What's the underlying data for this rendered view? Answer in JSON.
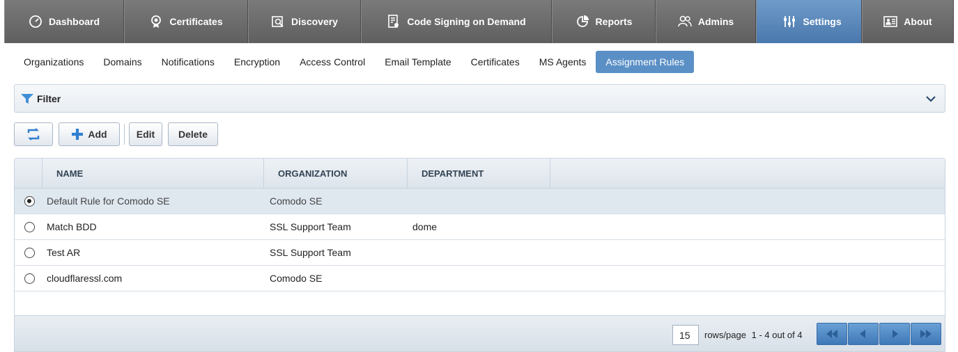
{
  "topnav": {
    "tabs": [
      {
        "label": "Dashboard",
        "icon": "dashboard-icon"
      },
      {
        "label": "Certificates",
        "icon": "certificate-icon"
      },
      {
        "label": "Discovery",
        "icon": "discovery-icon"
      },
      {
        "label": "Code Signing on Demand",
        "icon": "code-signing-icon"
      },
      {
        "label": "Reports",
        "icon": "reports-icon"
      },
      {
        "label": "Admins",
        "icon": "admins-icon"
      },
      {
        "label": "Settings",
        "icon": "settings-icon"
      },
      {
        "label": "About",
        "icon": "about-icon"
      }
    ],
    "active": "Settings"
  },
  "subnav": {
    "items": [
      "Organizations",
      "Domains",
      "Notifications",
      "Encryption",
      "Access Control",
      "Email Template",
      "Certificates",
      "MS Agents",
      "Assignment Rules"
    ],
    "active": "Assignment Rules"
  },
  "filter": {
    "label": "Filter"
  },
  "toolbar": {
    "add_label": "Add",
    "edit_label": "Edit",
    "delete_label": "Delete"
  },
  "table": {
    "columns": [
      "NAME",
      "ORGANIZATION",
      "DEPARTMENT"
    ],
    "rows": [
      {
        "name": "Default Rule for Comodo SE",
        "organization": "Comodo SE",
        "department": "",
        "selected": true
      },
      {
        "name": "Match BDD",
        "organization": "SSL Support Team",
        "department": "dome",
        "selected": false
      },
      {
        "name": "Test AR",
        "organization": "SSL Support Team",
        "department": "",
        "selected": false
      },
      {
        "name": "cloudflaressl.com",
        "organization": "Comodo SE",
        "department": "",
        "selected": false
      }
    ]
  },
  "pagination": {
    "rows_per_page": "15",
    "rows_per_page_label": "rows/page",
    "range_text": "1 - 4 out of 4"
  },
  "colors": {
    "nav_bg": "#6f6f6f",
    "accent": "#5b90c6",
    "pager": "#4a84c2"
  }
}
